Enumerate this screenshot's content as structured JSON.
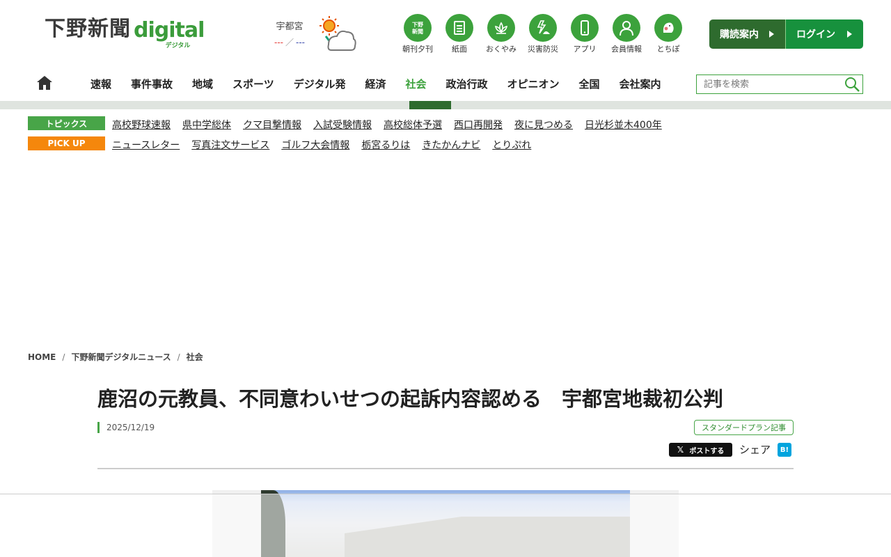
{
  "site": {
    "logo_main": "下野新聞",
    "logo_digital": "digital",
    "logo_sub": "デジタル"
  },
  "weather": {
    "city": "宇都宮",
    "high": "---",
    "separator": "／",
    "low": "---",
    "icon": "sunny-then-cloudy-icon"
  },
  "icon_nav": [
    {
      "label": "朝刊夕刊",
      "icon": "newspaper-logo-icon"
    },
    {
      "label": "紙面",
      "icon": "document-icon"
    },
    {
      "label": "おくやみ",
      "icon": "lotus-icon"
    },
    {
      "label": "災害防災",
      "icon": "disaster-icon"
    },
    {
      "label": "アプリ",
      "icon": "smartphone-icon"
    },
    {
      "label": "会員情報",
      "icon": "person-icon"
    },
    {
      "label": "とちぽ",
      "icon": "mascot-icon"
    }
  ],
  "buttons": {
    "subscribe": "購読案内",
    "login": "ログイン"
  },
  "nav": {
    "items": [
      "速報",
      "事件事故",
      "地域",
      "スポーツ",
      "デジタル発",
      "経済",
      "社会",
      "政治行政",
      "オピニオン",
      "全国",
      "会社案内"
    ],
    "active": "社会",
    "search_placeholder": "記事を検索"
  },
  "topics": {
    "topics_label": "トピックス",
    "topics_links": [
      "高校野球速報",
      "県中学総体",
      "クマ目撃情報",
      "入試受験情報",
      "高校総体予選",
      "西口再開発",
      "夜に見つめる",
      "日光杉並木400年"
    ],
    "pickup_label": "PICK UP",
    "pickup_links": [
      "ニュースレター",
      "写真注文サービス",
      "ゴルフ大会情報",
      "栃宮るりは",
      "きたかんナビ",
      "とりぷれ"
    ]
  },
  "breadcrumb": [
    "HOME",
    "下野新聞デジタルニュース",
    "社会"
  ],
  "article": {
    "title": "鹿沼の元教員、不同意わいせつの起訴内容認める　宇都宮地裁初公判",
    "date": "2025/12/19",
    "plan_badge": "スタンダードプラン記事",
    "x_post": "ポストする",
    "share": "シェア",
    "hatena": "B!"
  },
  "colors": {
    "brand_green": "#3ca23c",
    "dark_green": "#2e6b2e",
    "pickup_orange": "#f5870c"
  }
}
